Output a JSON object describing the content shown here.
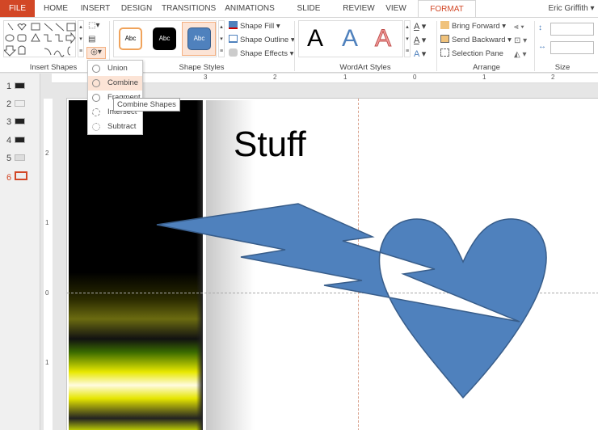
{
  "tabs": [
    "FILE",
    "HOME",
    "INSERT",
    "DESIGN",
    "TRANSITIONS",
    "ANIMATIONS",
    "SLIDE SHOW",
    "REVIEW",
    "VIEW",
    "FORMAT"
  ],
  "user": "Eric Griffith",
  "ribbon": {
    "groups": {
      "insert_shapes": "Insert Shapes",
      "shape_styles": "Shape Styles",
      "wordart_styles": "WordArt Styles",
      "arrange": "Arrange",
      "size": "Size"
    },
    "style_samples": [
      "Abc",
      "Abc",
      "Abc"
    ],
    "shape_fill": "Shape Fill",
    "shape_outline": "Shape Outline",
    "shape_effects": "Shape Effects",
    "wordart_samples": [
      "A",
      "A",
      "A"
    ],
    "bring_forward": "Bring Forward",
    "send_backward": "Send Backward",
    "selection_pane": "Selection Pane",
    "height_value": "",
    "width_value": ""
  },
  "merge_menu": {
    "items": [
      "Union",
      "Combine",
      "Fragment",
      "Intersect",
      "Subtract"
    ],
    "highlighted": "Combine",
    "tooltip": "Combine Shapes"
  },
  "ruler": {
    "h": [
      "3",
      "2",
      "1",
      "0",
      "1",
      "2"
    ],
    "v": [
      "2",
      "1",
      "0",
      "1"
    ]
  },
  "slides": {
    "numbers": [
      "1",
      "2",
      "3",
      "4",
      "5",
      "6"
    ],
    "selected": "6"
  },
  "slide": {
    "title": "Stuff"
  },
  "colors": {
    "accent": "#d24726",
    "shape_fill": "#4f81bd",
    "shape_stroke": "#385d8a"
  }
}
